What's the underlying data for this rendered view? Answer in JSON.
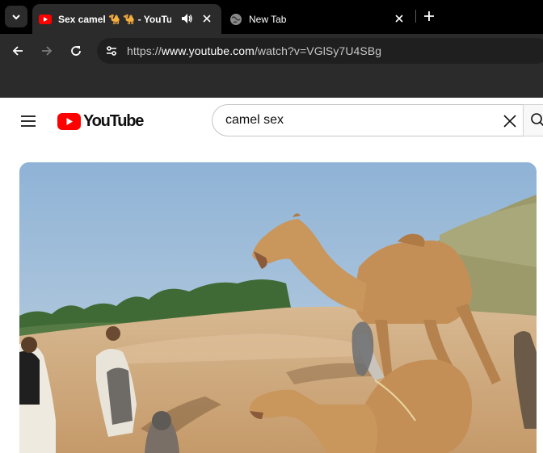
{
  "browser": {
    "tabs": [
      {
        "title": "Sex camel 🐪 🐪 - YouTube",
        "active": true
      },
      {
        "title": "New Tab",
        "active": false
      }
    ],
    "url": {
      "prefix": "https://",
      "host": "www.youtube.com",
      "path": "/watch?v=VGlSy7U4SBg"
    }
  },
  "youtube": {
    "logo_text": "YouTube",
    "search": {
      "value": "camel sex"
    }
  },
  "icons": {
    "tab_search": "chevron-down-icon",
    "youtube_favicon": "youtube-favicon-icon",
    "audio": "speaker-icon",
    "close": "close-icon",
    "globe": "globe-icon",
    "new_tab": "plus-icon",
    "back": "arrow-left-icon",
    "forward": "arrow-right-icon",
    "reload": "reload-icon",
    "site_info": "tune-icon",
    "menu": "hamburger-icon",
    "search_clear": "close-icon",
    "search": "search-icon"
  },
  "colors": {
    "chrome_dark": "#000000",
    "chrome_toolbar": "#2b2b2b",
    "youtube_red": "#ff0000",
    "sky": "#9bb8d4",
    "sand": "#d9b68b",
    "camel": "#c9965c"
  }
}
